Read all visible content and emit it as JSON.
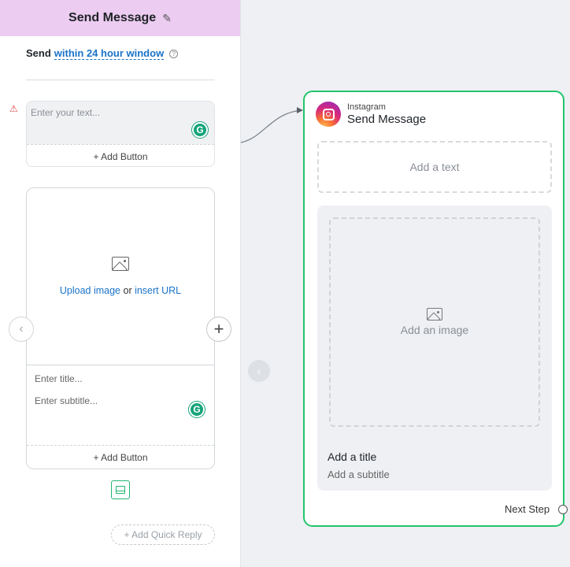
{
  "panel": {
    "title": "Send Message",
    "send_label": "Send",
    "window_link": "within 24 hour window",
    "text_placeholder": "Enter your text...",
    "add_button_label": "+ Add Button",
    "media": {
      "upload_link": "Upload image",
      "or_text": " or ",
      "insert_link": "insert URL",
      "title_placeholder": "Enter title...",
      "subtitle_placeholder": "Enter subtitle...",
      "add_button_label": "+ Add Button"
    },
    "quick_reply_label": "+ Add Quick Reply"
  },
  "node": {
    "platform": "Instagram",
    "title": "Send Message",
    "add_text_label": "Add a text",
    "add_image_label": "Add an image",
    "card_title": "Add a title",
    "card_subtitle": "Add a subtitle",
    "next_step_label": "Next Step"
  },
  "icons": {
    "edit": "pencil-icon",
    "help": "question-circle-icon",
    "warning": "warning-triangle-icon",
    "grammarly": "grammarly-icon",
    "image": "image-icon",
    "prev": "chevron-left-icon",
    "add": "plus-icon",
    "collapse": "collapse-icon"
  },
  "colors": {
    "header_bg": "#ecccf1",
    "link": "#1a73c8",
    "node_border": "#22c56b",
    "grammarly": "#15a47a",
    "warning": "#e04848"
  }
}
